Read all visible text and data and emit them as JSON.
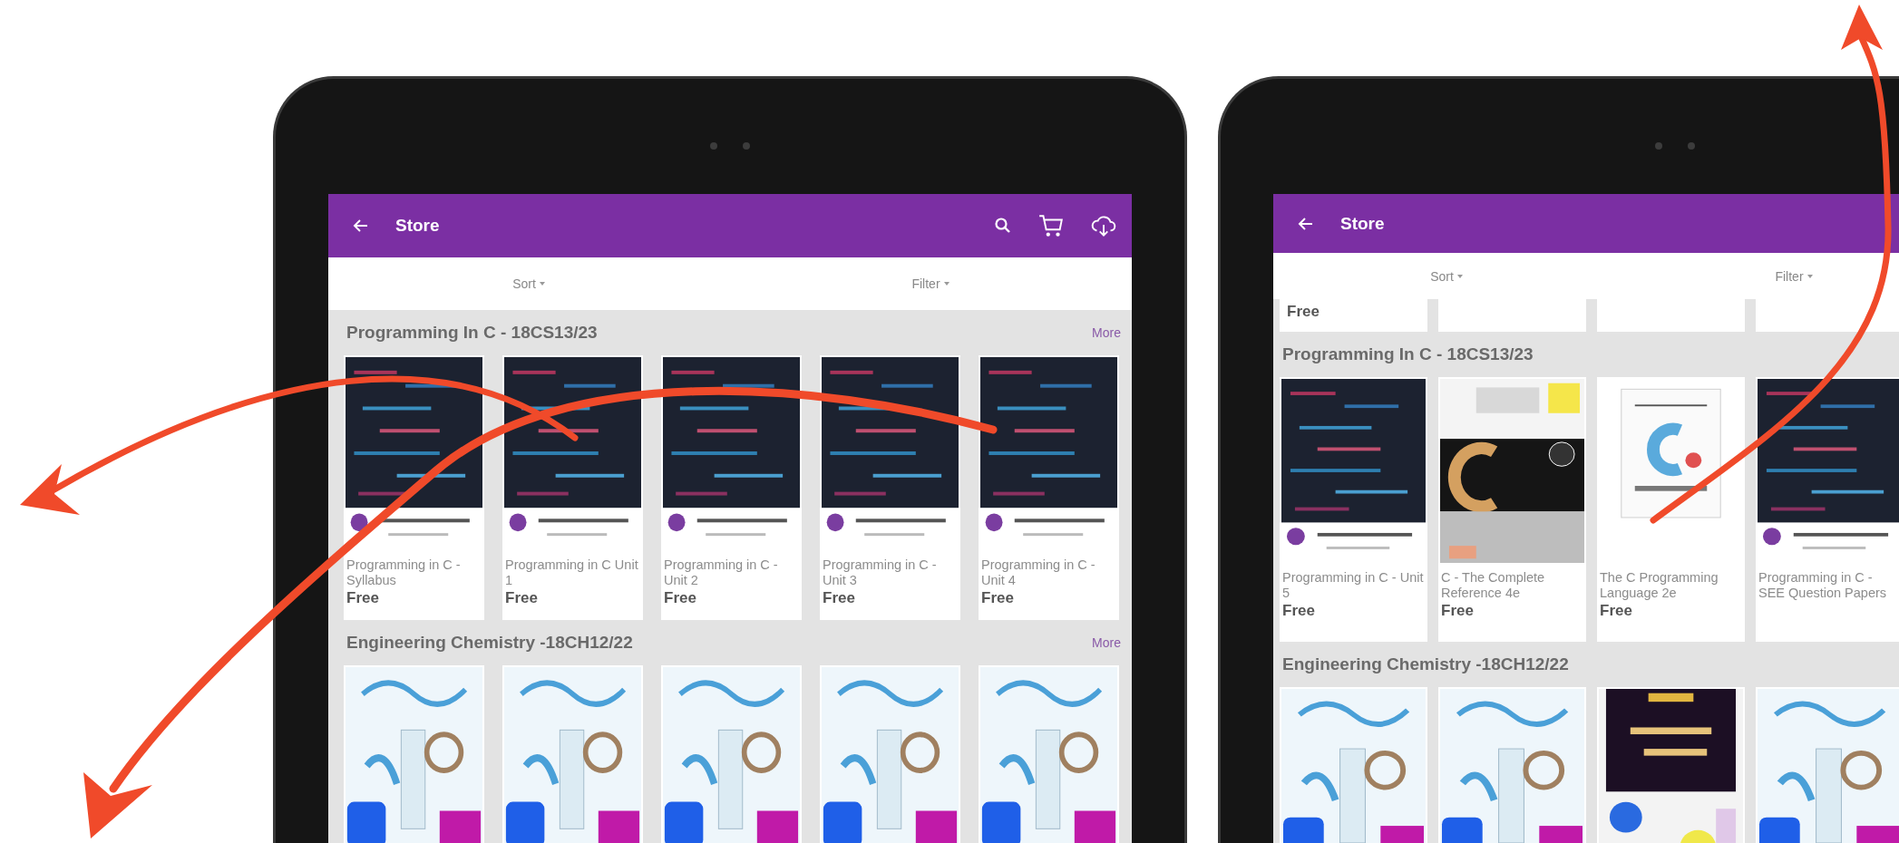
{
  "devices": [
    {
      "app_bar": {
        "title": "Store",
        "actions": true
      },
      "toolbar": [
        "Sort",
        "Filter"
      ],
      "sections": [
        {
          "title": "Programming In C - 18CS13/23",
          "more": "More",
          "items": [
            {
              "kind": "code",
              "title": "Programming in C - Syllabus",
              "price": "Free"
            },
            {
              "kind": "code",
              "title": "Programming in C Unit 1",
              "price": "Free"
            },
            {
              "kind": "code",
              "title": "Programming in C - Unit 2",
              "price": "Free"
            },
            {
              "kind": "code",
              "title": "Programming in C - Unit 3",
              "price": "Free"
            },
            {
              "kind": "code",
              "title": "Programming in C - Unit 4",
              "price": "Free"
            }
          ]
        },
        {
          "title": "Engineering Chemistry -18CH12/22",
          "more": "More",
          "items": [
            {
              "kind": "lab"
            },
            {
              "kind": "lab"
            },
            {
              "kind": "lab"
            },
            {
              "kind": "lab"
            },
            {
              "kind": "lab"
            }
          ]
        }
      ]
    },
    {
      "app_bar": {
        "title": "Store",
        "actions": false
      },
      "toolbar": [
        "Sort",
        "Filter"
      ],
      "scrolled_price": "Free",
      "sections": [
        {
          "title": "Programming In C - 18CS13/23",
          "items": [
            {
              "kind": "code",
              "title": "Programming in C - Unit 5",
              "price": "Free"
            },
            {
              "kind": "reference",
              "title": "C - The Complete Reference 4e",
              "price": "Free"
            },
            {
              "kind": "classic",
              "title": "The C Programming Language 2e",
              "price": "Free"
            },
            {
              "kind": "code",
              "title": "Programming in C - SEE Question Papers"
            }
          ]
        },
        {
          "title": "Engineering Chemistry -18CH12/22",
          "items": [
            {
              "kind": "lab"
            },
            {
              "kind": "lab"
            },
            {
              "kind": "textbook"
            },
            {
              "kind": "lab"
            }
          ]
        }
      ]
    }
  ]
}
